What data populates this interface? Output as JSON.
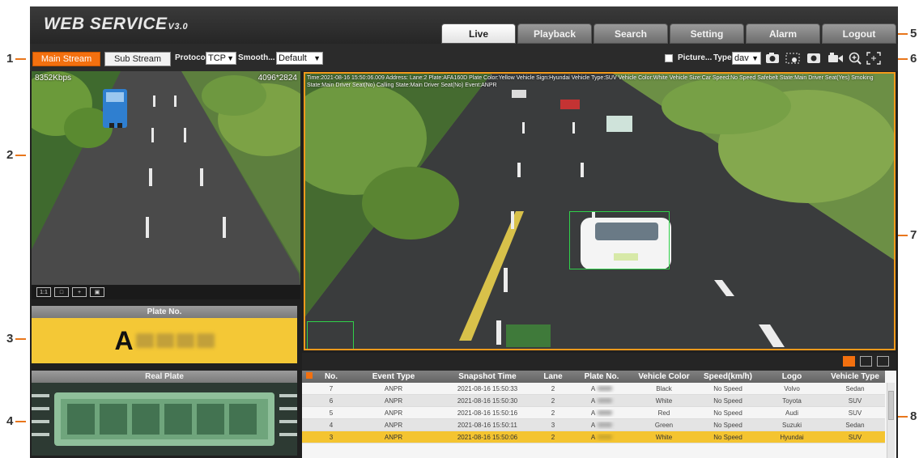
{
  "header": {
    "logo_main": "WEB  SERVICE",
    "logo_version": "V3.0",
    "tabs": [
      {
        "label": "Live"
      },
      {
        "label": "Playback"
      },
      {
        "label": "Search"
      },
      {
        "label": "Setting"
      },
      {
        "label": "Alarm"
      },
      {
        "label": "Logout"
      }
    ]
  },
  "toolbar": {
    "main_stream": "Main Stream",
    "sub_stream": "Sub Stream",
    "protocol_label": "Protocol",
    "protocol_value": "TCP",
    "smooth_label": "Smooth...",
    "smooth_value": "Default",
    "picture_label": "Picture...",
    "type_label": "Type",
    "type_value": "dav"
  },
  "left_video": {
    "bitrate": "8352Kbps",
    "resolution": "4096*2824"
  },
  "main_video": {
    "overlay": "Time:2021-08-16 15:50:06.009  Address:  Lane:2  Plate:AFA160D  Plate Color:Yellow  Vehicle Sign:Hyundai  Vehicle Type:SUV  Vehicle Color:White  Vehicle Size:Car  Speed:No Speed  Safebelt State:Main Driver Seat(Yes)  Smoking State:Main Driver Seat(No)  Calling State:Main Driver Seat(No)  Event:ANPR"
  },
  "plate_panel": {
    "title": "Plate No.",
    "value_prefix": "A"
  },
  "real_plate_panel": {
    "title": "Real Plate"
  },
  "event_table": {
    "columns": [
      "No.",
      "Event Type",
      "Snapshot Time",
      "Lane",
      "Plate No.",
      "Vehicle Color",
      "Speed(km/h)",
      "Logo",
      "Vehicle Type"
    ],
    "rows": [
      {
        "no": "7",
        "event": "ANPR",
        "time": "2021-08-16 15:50:33",
        "lane": "2",
        "plate": "A",
        "color": "Black",
        "speed": "No Speed",
        "logo": "Volvo",
        "vtype": "Sedan"
      },
      {
        "no": "6",
        "event": "ANPR",
        "time": "2021-08-16 15:50:30",
        "lane": "2",
        "plate": "A",
        "color": "White",
        "speed": "No Speed",
        "logo": "Toyota",
        "vtype": "SUV"
      },
      {
        "no": "5",
        "event": "ANPR",
        "time": "2021-08-16 15:50:16",
        "lane": "2",
        "plate": "A",
        "color": "Red",
        "speed": "No Speed",
        "logo": "Audi",
        "vtype": "SUV"
      },
      {
        "no": "4",
        "event": "ANPR",
        "time": "2021-08-16 15:50:11",
        "lane": "3",
        "plate": "A",
        "color": "Green",
        "speed": "No Speed",
        "logo": "Suzuki",
        "vtype": "Sedan"
      },
      {
        "no": "3",
        "event": "ANPR",
        "time": "2021-08-16 15:50:06",
        "lane": "2",
        "plate": "A",
        "color": "White",
        "speed": "No Speed",
        "logo": "Hyundai",
        "vtype": "SUV"
      }
    ]
  },
  "callouts": [
    "1",
    "2",
    "3",
    "4",
    "5",
    "6",
    "7",
    "8"
  ],
  "colors": {
    "accent": "#f3700f",
    "selected_row": "#f4c430",
    "plate_yellow": "#f4c836",
    "video_border": "#f39a1b"
  }
}
